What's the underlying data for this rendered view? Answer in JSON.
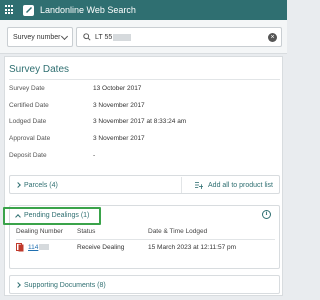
{
  "app": {
    "title": "Landonline Web Search"
  },
  "search": {
    "type_value": "Survey number",
    "query_value": "LT 55"
  },
  "survey_dates": {
    "title": "Survey Dates",
    "rows": [
      {
        "label": "Survey Date",
        "value": "13 October 2017"
      },
      {
        "label": "Certified Date",
        "value": "3 November 2017"
      },
      {
        "label": "Lodged Date",
        "value": "3 November 2017 at 8:33:24 am"
      },
      {
        "label": "Approval Date",
        "value": "3 November 2017"
      },
      {
        "label": "Deposit Date",
        "value": "-"
      }
    ]
  },
  "parcels": {
    "label": "Parcels (4)",
    "add_label": "Add all to product list"
  },
  "pending_dealings": {
    "label": "Pending Dealings (1)",
    "columns": [
      "Dealing Number",
      "Status",
      "Date & Time Lodged"
    ],
    "rows": [
      {
        "number": "114",
        "status": "Receive Dealing",
        "lodged": "15 March 2023 at 12:11:57 pm"
      }
    ]
  },
  "supporting_documents": {
    "label": "Supporting Documents (8)"
  },
  "colors": {
    "header": "#2f6f71",
    "accent": "#2f6f71",
    "highlight": "#3aa34a",
    "link": "#1f6fb0"
  }
}
